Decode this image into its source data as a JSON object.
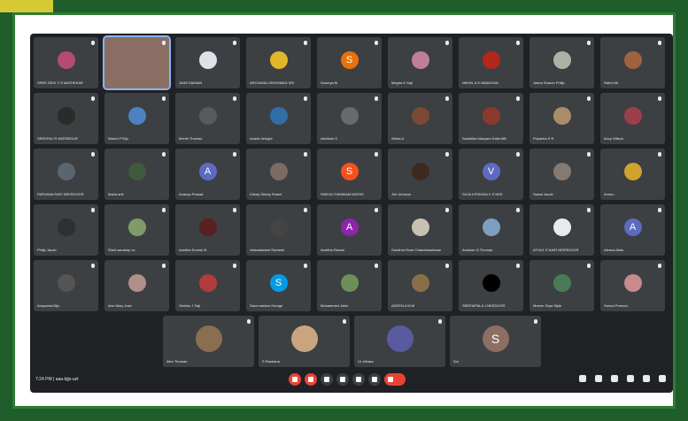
{
  "meeting": {
    "time": "7:24 PM",
    "separator": "|",
    "code": "aaa-bjjs-uzt"
  },
  "participants_rows": [
    [
      {
        "name": "SREE DEVI V S MATHEKAR",
        "initial": "",
        "color": "#b54b73"
      },
      {
        "name": "",
        "initial": "",
        "color": "#8a6e63",
        "selected": true
      },
      {
        "name": "JAINI SAIMAN",
        "initial": "",
        "color": "#dbe3e9"
      },
      {
        "name": "ARCHANA LEKSHMAN SRI",
        "initial": "",
        "color": "#e0b72a"
      },
      {
        "name": "Soumya M",
        "initial": "S",
        "color": "#e8710a"
      },
      {
        "name": "Megha K Saji",
        "initial": "",
        "color": "#bf7f98"
      },
      {
        "name": "NIKHIL A S NANDHAN",
        "initial": "",
        "color": "#b3261e"
      },
      {
        "name": "Jasna Sharon Philip",
        "initial": "",
        "color": "#aab3a6"
      },
      {
        "name": "Rahul Mr",
        "initial": "",
        "color": "#a0623f"
      }
    ],
    [
      {
        "name": "SREERAJ R NEEREDUR",
        "initial": "",
        "color": "#2b2b2b"
      },
      {
        "name": "Nimmi P Biju",
        "initial": "",
        "color": "#4c82c2"
      },
      {
        "name": "Merlin Thomas",
        "initial": "",
        "color": "#5a5a5a"
      },
      {
        "name": "Ananti Jeregni",
        "initial": "",
        "color": "#2f6fa5"
      },
      {
        "name": "Akhilesh S",
        "initial": "",
        "color": "#6a6a6a"
      },
      {
        "name": "Athira A",
        "initial": "",
        "color": "#7b4a33"
      },
      {
        "name": "Swathika Mariyam Kalla MB",
        "initial": "",
        "color": "#8b3a2a"
      },
      {
        "name": "Priyanka S R",
        "initial": "",
        "color": "#aa8c6a"
      },
      {
        "name": "Ancy Wilson",
        "initial": "",
        "color": "#9c3f4a"
      }
    ],
    [
      {
        "name": "PARVANA RAFI NEERDOOR",
        "initial": "",
        "color": "#5a6570"
      },
      {
        "name": "Maria anil",
        "initial": "",
        "color": "#3f5a3c"
      },
      {
        "name": "Ananya Prasad",
        "initial": "A",
        "color": "#5c6bc0"
      },
      {
        "name": "Dileep Dileep Shami",
        "initial": "",
        "color": "#7d6a63"
      },
      {
        "name": "SNEHA THANKAM MATHE",
        "initial": "S",
        "color": "#f4511e"
      },
      {
        "name": "Jini Johnson",
        "initial": "",
        "color": "#3c2a20"
      },
      {
        "name": "SUJA KRISHNA V S NEE",
        "initial": "V",
        "color": "#5c6bc0"
      },
      {
        "name": "Swani Jacob",
        "initial": "",
        "color": "#847a72"
      },
      {
        "name": "Ammu",
        "initial": "",
        "color": "#d0a22e"
      }
    ],
    [
      {
        "name": "Philip Jacob",
        "initial": "",
        "color": "#2f2f2f"
      },
      {
        "name": "Sheli sandeep cs",
        "initial": "",
        "color": "#7f9b6a"
      },
      {
        "name": "Aneitha Suresh B",
        "initial": "",
        "color": "#5a1f1f"
      },
      {
        "name": "Valsalakshmi Ramesh",
        "initial": "",
        "color": "#444"
      },
      {
        "name": "Amritha Renda",
        "initial": "A",
        "color": "#8e24aa"
      },
      {
        "name": "Sandhra Rose Chandrasekaran",
        "initial": "",
        "color": "#c9c0b2"
      },
      {
        "name": "Anishan G Thomas",
        "initial": "",
        "color": "#7c9fc0"
      },
      {
        "name": "ATHUL S NAIR NEERDOOR",
        "initial": "",
        "color": "#e8eaed"
      },
      {
        "name": "Aleena Aleiu",
        "initial": "A",
        "color": "#5c6bc0"
      }
    ],
    [
      {
        "name": "Anupama Biju",
        "initial": "",
        "color": "#555"
      },
      {
        "name": "Ann Mary Jose",
        "initial": "",
        "color": "#b08f8a"
      },
      {
        "name": "Geethu J Saji",
        "initial": "",
        "color": "#b23b3b"
      },
      {
        "name": "Sara mariam George",
        "initial": "S",
        "color": "#039be5"
      },
      {
        "name": "Mohammed Jabir",
        "initial": "",
        "color": "#6f8f58"
      },
      {
        "name": "ADEEN A M M",
        "initial": "",
        "color": "#8a6e4a"
      },
      {
        "name": "SREEMPALA J NEEDOOR",
        "initial": "",
        "color": "#000000"
      },
      {
        "name": "Mueen Zeya Siple",
        "initial": "",
        "color": "#4a7a55"
      },
      {
        "name": "Sanna Pramod",
        "initial": "",
        "color": "#c78b8b"
      }
    ]
  ],
  "last_row": [
    {
      "name": "Alex Thomas",
      "initial": "",
      "color": "#8a6e50"
    },
    {
      "name": "S Rashana",
      "initial": "",
      "color": "#c9a480"
    },
    {
      "name": "Ur Jebara",
      "initial": "",
      "color": "#5a5aa0"
    },
    {
      "name": "Sro",
      "initial": "S",
      "color": "#8d6e63"
    }
  ],
  "controls": [
    "mic-off",
    "camera-off",
    "captions",
    "raise-hand",
    "present",
    "more",
    "end-call"
  ],
  "right_controls": [
    "info",
    "people",
    "chat",
    "activities",
    "host-controls",
    "lock"
  ]
}
